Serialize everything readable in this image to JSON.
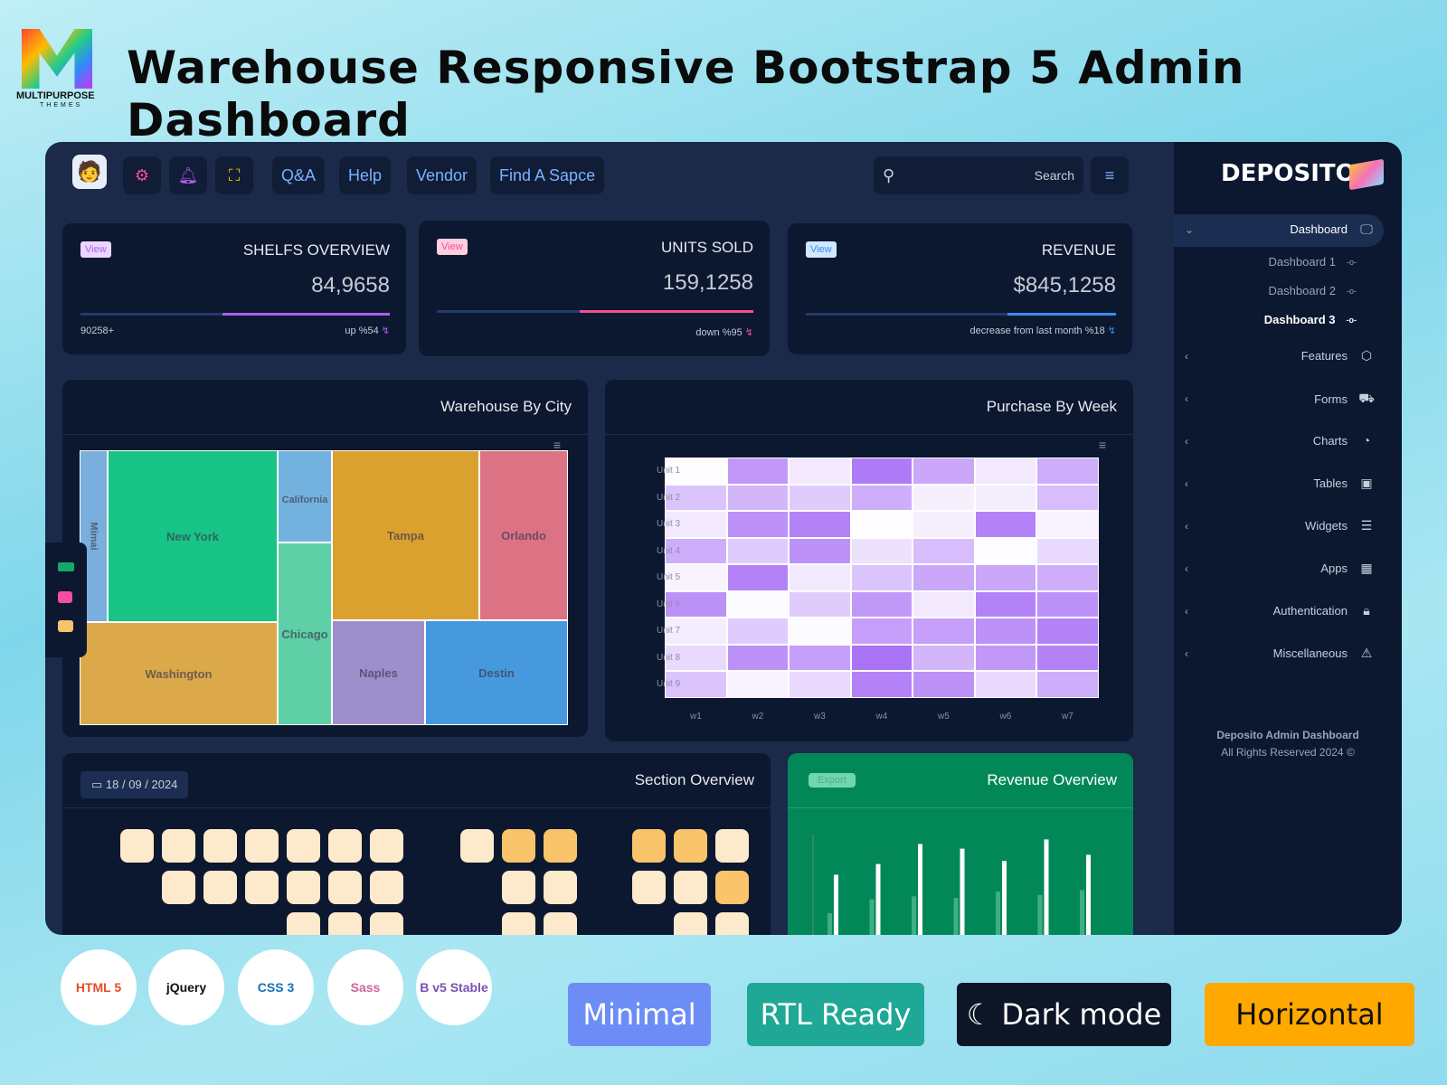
{
  "brand": {
    "logo_text": "MULTIPURPOSE",
    "logo_sub": "THEMES",
    "headline": "Warehouse Responsive Bootstrap 5 Admin Dashboard"
  },
  "topbar": {
    "buttons": [
      "Q&A",
      "Help",
      "Vendor",
      "Find A Sapce"
    ],
    "icons": [
      "avatar",
      "gear-icon",
      "bell-icon",
      "fullscreen-icon"
    ],
    "search_placeholder": "Search"
  },
  "stats": [
    {
      "view": "View",
      "title": "SHELFS OVERVIEW",
      "value": "84,9658",
      "progress": 54,
      "left": "90258+",
      "right": "up %54",
      "color": "#b05cf0"
    },
    {
      "view": "View",
      "title": "UNITS SOLD",
      "value": "159,1258",
      "progress": 55,
      "left": "",
      "right": "down %95",
      "color": "#f44f8f"
    },
    {
      "view": "View",
      "title": "REVENUE",
      "value": "$845,1258",
      "progress": 35,
      "left": "",
      "right": "decrease from last month %18",
      "color": "#3b8cf0"
    }
  ],
  "treemap": {
    "title": "Warehouse By City",
    "cells": [
      {
        "name": "Mimai",
        "color": "#7aaedc"
      },
      {
        "name": "New York",
        "color": "#17c486"
      },
      {
        "name": "California",
        "color": "#73b2de"
      },
      {
        "name": "Chicago",
        "color": "#5ecfa6"
      },
      {
        "name": "Tampa",
        "color": "#dba12f"
      },
      {
        "name": "Orlando",
        "color": "#dc7385"
      },
      {
        "name": "Washington",
        "color": "#dca94a"
      },
      {
        "name": "Naples",
        "color": "#9d8fcc"
      },
      {
        "name": "Destin",
        "color": "#4699dd"
      }
    ]
  },
  "chart_data": [
    {
      "type": "heatmap",
      "title": "Purchase By Week",
      "x": [
        "w1",
        "w2",
        "w3",
        "w4",
        "w5",
        "w6",
        "w7"
      ],
      "y": [
        "Unit 1",
        "Unit 2",
        "Unit 3",
        "Unit 4",
        "Unit 5",
        "Unit 6",
        "Unit 7",
        "Unit 8",
        "Unit 9"
      ],
      "values": [
        [
          2,
          70,
          15,
          90,
          60,
          15,
          55
        ],
        [
          40,
          50,
          35,
          55,
          10,
          12,
          45
        ],
        [
          15,
          75,
          85,
          2,
          10,
          85,
          8
        ],
        [
          55,
          35,
          75,
          20,
          45,
          2,
          25
        ],
        [
          8,
          85,
          15,
          40,
          60,
          60,
          55
        ],
        [
          75,
          3,
          35,
          70,
          15,
          85,
          75
        ],
        [
          12,
          35,
          3,
          65,
          65,
          75,
          85
        ],
        [
          25,
          75,
          65,
          95,
          50,
          70,
          85
        ],
        [
          40,
          8,
          25,
          85,
          75,
          25,
          55
        ]
      ],
      "color": "#a66cf5"
    },
    {
      "type": "bar",
      "title": "Revenue Overview",
      "series": [
        {
          "values": [
            30,
            39,
            41,
            40,
            44,
            42,
            45
          ]
        },
        {
          "values": [
            55,
            62,
            75,
            72,
            64,
            78,
            68
          ]
        }
      ]
    }
  ],
  "section": {
    "title": "Section Overview",
    "date": "18 / 09 / 2024",
    "rows": [
      [
        "a",
        "a",
        "a",
        "a",
        "a",
        "a",
        "a",
        null,
        "a",
        "b",
        "b",
        null,
        "b",
        "b",
        "a"
      ],
      [
        null,
        "a",
        "a",
        "a",
        "a",
        "a",
        "a",
        null,
        null,
        "a",
        "a",
        null,
        "a",
        "a",
        "b"
      ],
      [
        null,
        null,
        null,
        null,
        "a",
        "a",
        "a",
        null,
        null,
        "a",
        "a",
        null,
        null,
        "a",
        "a"
      ]
    ],
    "colors": {
      "a": "#fde9cb",
      "b": "#f9c46a"
    }
  },
  "revenue": {
    "title": "Revenue Overview",
    "export": "Export"
  },
  "sidebar": {
    "logo": "DEPOSITO",
    "items": [
      {
        "label": "Dashboard",
        "icon": "monitor-icon",
        "glyph": "🖵"
      },
      {
        "label": "Features",
        "icon": "cube-icon",
        "glyph": "⬡"
      },
      {
        "label": "Forms",
        "icon": "truck-icon",
        "glyph": "⛟"
      },
      {
        "label": "Charts",
        "icon": "pie-chart-icon",
        "glyph": "◔"
      },
      {
        "label": "Tables",
        "icon": "table-icon",
        "glyph": "▣"
      },
      {
        "label": "Widgets",
        "icon": "server-icon",
        "glyph": "☰"
      },
      {
        "label": "Apps",
        "icon": "grid-icon",
        "glyph": "▦"
      },
      {
        "label": "Authentication",
        "icon": "lock-icon",
        "glyph": "🔒︎"
      },
      {
        "label": "Miscellaneous",
        "icon": "alert-icon",
        "glyph": "⚠"
      }
    ],
    "sub": [
      "Dashboard 1",
      "Dashboard 2",
      "Dashboard 3"
    ],
    "footer1": "Deposito Admin Dashboard",
    "footer2": "All Rights Reserved 2024 ©"
  },
  "tech": [
    "HTML 5",
    "jQuery",
    "CSS 3",
    "Sass",
    "B v5 Stable"
  ],
  "features": [
    {
      "label": "Minimal",
      "color": "#6c8df5"
    },
    {
      "label": "RTL Ready",
      "color": "#1fa895"
    },
    {
      "label": "Dark mode",
      "color": "#0c1626"
    },
    {
      "label": "Horizontal",
      "color": "#ffa800"
    }
  ]
}
